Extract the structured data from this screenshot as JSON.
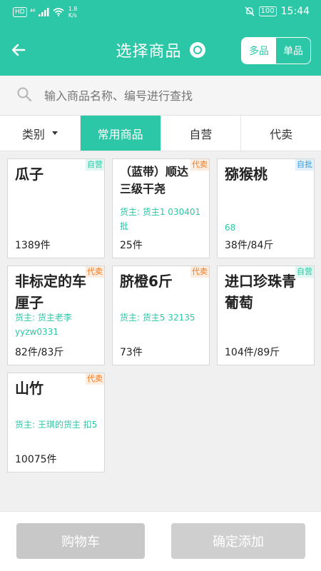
{
  "status": {
    "hd": "HD",
    "net": "⁴⁶",
    "speed_value": "1.8",
    "speed_unit": "K/s",
    "battery": "100",
    "time": "15:44"
  },
  "header": {
    "title": "选择商品",
    "mode_multi": "多品",
    "mode_single": "单品"
  },
  "search": {
    "placeholder": "输入商品名称、编号进行查找"
  },
  "tabs": [
    {
      "label": "类别"
    },
    {
      "label": "常用商品"
    },
    {
      "label": "自营"
    },
    {
      "label": "代卖"
    }
  ],
  "products": [
    {
      "name": "瓜子",
      "badge": "自营",
      "owner": "",
      "qty": "1389件"
    },
    {
      "name": "（蓝带）顺达三级干尧",
      "badge": "代卖",
      "owner": "货主: 货主1 030401批",
      "qty": "25件"
    },
    {
      "name": "猕猴桃",
      "badge": "自批",
      "owner": "68",
      "qty": "38件/84斤"
    },
    {
      "name": "非标定的车厘子",
      "badge": "代卖",
      "owner": "货主: 货主老李 yyzw0331",
      "qty": "82件/83斤"
    },
    {
      "name": "脐橙6斤",
      "badge": "代卖",
      "owner": "货主: 货主5 32135",
      "qty": "73件"
    },
    {
      "name": "进口珍珠青葡萄",
      "badge": "自营",
      "owner": "",
      "qty": "104件/89斤"
    },
    {
      "name": "山竹",
      "badge": "代卖",
      "owner": "货主: 王琪的货主 扣5",
      "qty": "10075件"
    }
  ],
  "footer": {
    "cart": "购物车",
    "confirm": "确定添加"
  },
  "colors": {
    "accent": "#2bc7a6",
    "badge_zy": "#2bc7a6",
    "badge_dm": "#f07a1f",
    "badge_zp": "#3a9ad9"
  },
  "icons": {
    "back": "arrow-left-icon",
    "title": "gear-icon",
    "search": "search-icon",
    "caret": "caret-down-icon"
  }
}
